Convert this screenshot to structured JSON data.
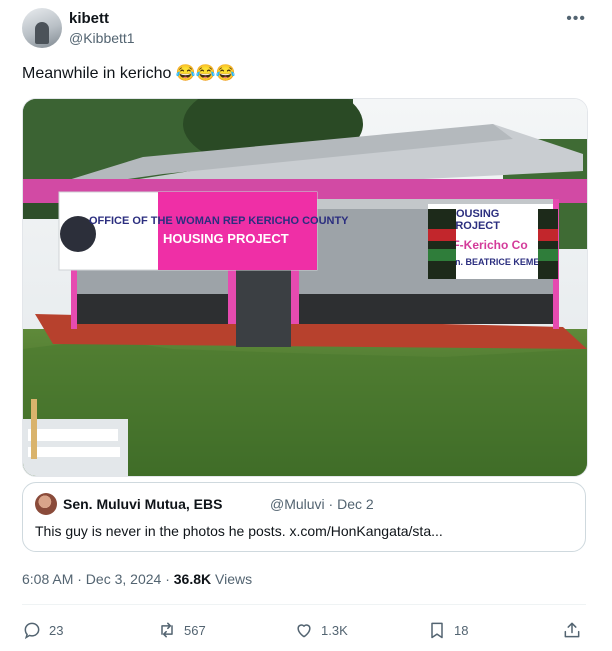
{
  "tweet": {
    "author_name": "kibett",
    "author_handle": "@Kibbett1",
    "text": "Meanwhile in kericho 😂😂😂",
    "timestamp": "6:08 AM · Dec 3, 2024 · ",
    "views_count": "36.8K",
    "views_label": " Views"
  },
  "photo_text": {
    "banner_left_line1": "OFFICE OF THE WOMAN REP KERICHO COUNTY",
    "banner_left_line2": "HOUSING PROJECT",
    "banner_right_line1": "HOUSING",
    "banner_right_line2": "PROJECT",
    "banner_right_line3": "AAF-Kericho Co",
    "banner_right_line4": "Hon. BEATRICE KEMEI"
  },
  "quoted": {
    "author_name": "Sen. Muluvi Mutua, EBS",
    "author_handle": "@Muluvi · Dec 2",
    "text": "This guy is never in the photos he posts. x.com/HonKangata/sta..."
  },
  "actions": {
    "replies": "23",
    "reposts": "567",
    "likes": "1.3K",
    "bookmarks": "18"
  },
  "colors": {
    "text_primary": "#0f1419",
    "text_secondary": "#536471",
    "border": "#cfd9de",
    "house_pink": "#e64bb0"
  },
  "icons": [
    "more-icon",
    "reply-icon",
    "repost-icon",
    "like-icon",
    "bookmark-icon",
    "share-icon"
  ]
}
